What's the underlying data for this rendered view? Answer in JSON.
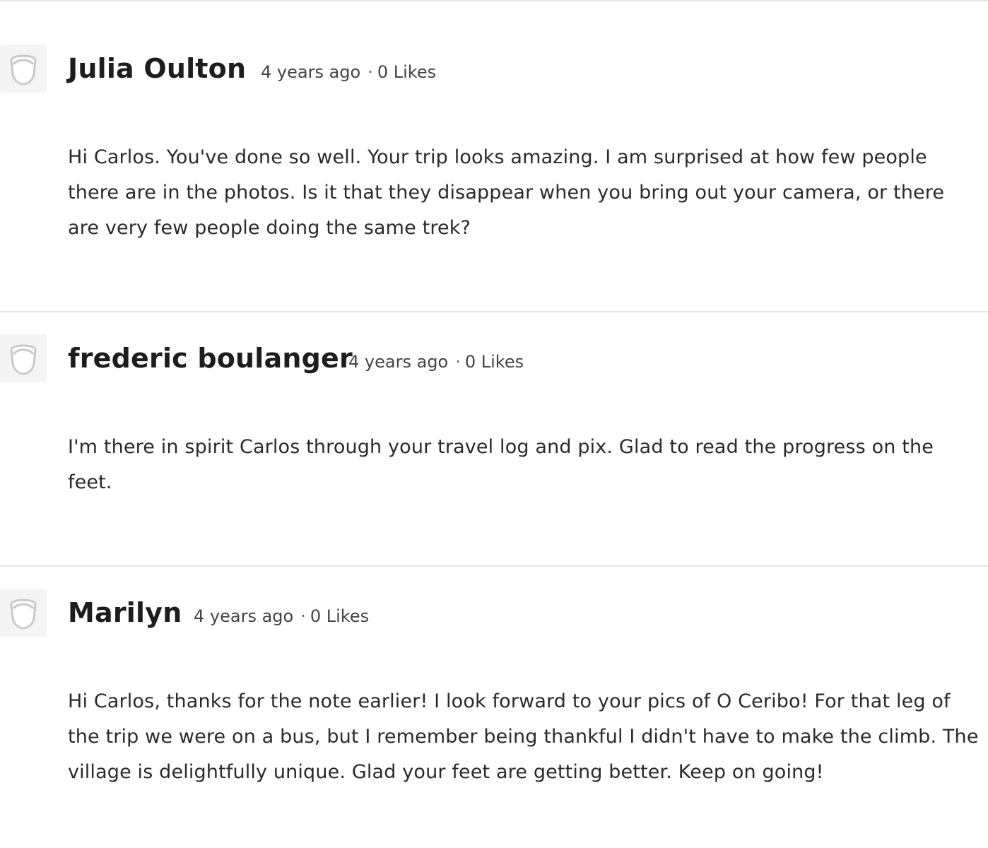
{
  "comments": [
    {
      "author": "Julia Oulton",
      "time": "4 years ago",
      "separator": "·",
      "likes": "0 Likes",
      "text": "Hi Carlos. You've done so well. Your trip looks amazing. I am surprised at how few people there are in the photos. Is it that they disappear when you bring out your camera, or there are very few people doing the same trek?"
    },
    {
      "author": "frederic boulanger",
      "time": "4 years ago",
      "separator": "·",
      "likes": "0 Likes",
      "text": "I'm there in spirit Carlos through your travel log and pix. Glad to read the progress on the feet."
    },
    {
      "author": "Marilyn",
      "time": "4 years ago",
      "separator": "·",
      "likes": "0 Likes",
      "text": "Hi Carlos, thanks for the note earlier! I look forward to your pics of O Ceribo! For that leg of the trip we were on a bus, but I remember being thankful I didn't have to make the climb. The village is delightfully unique. Glad your feet are getting better. Keep on going!"
    }
  ],
  "icons": {
    "avatar": "default-user-avatar-icon"
  },
  "colors": {
    "divider": "#e4e4e4",
    "avatar_bg": "#f4f4f4",
    "text": "#222222"
  }
}
